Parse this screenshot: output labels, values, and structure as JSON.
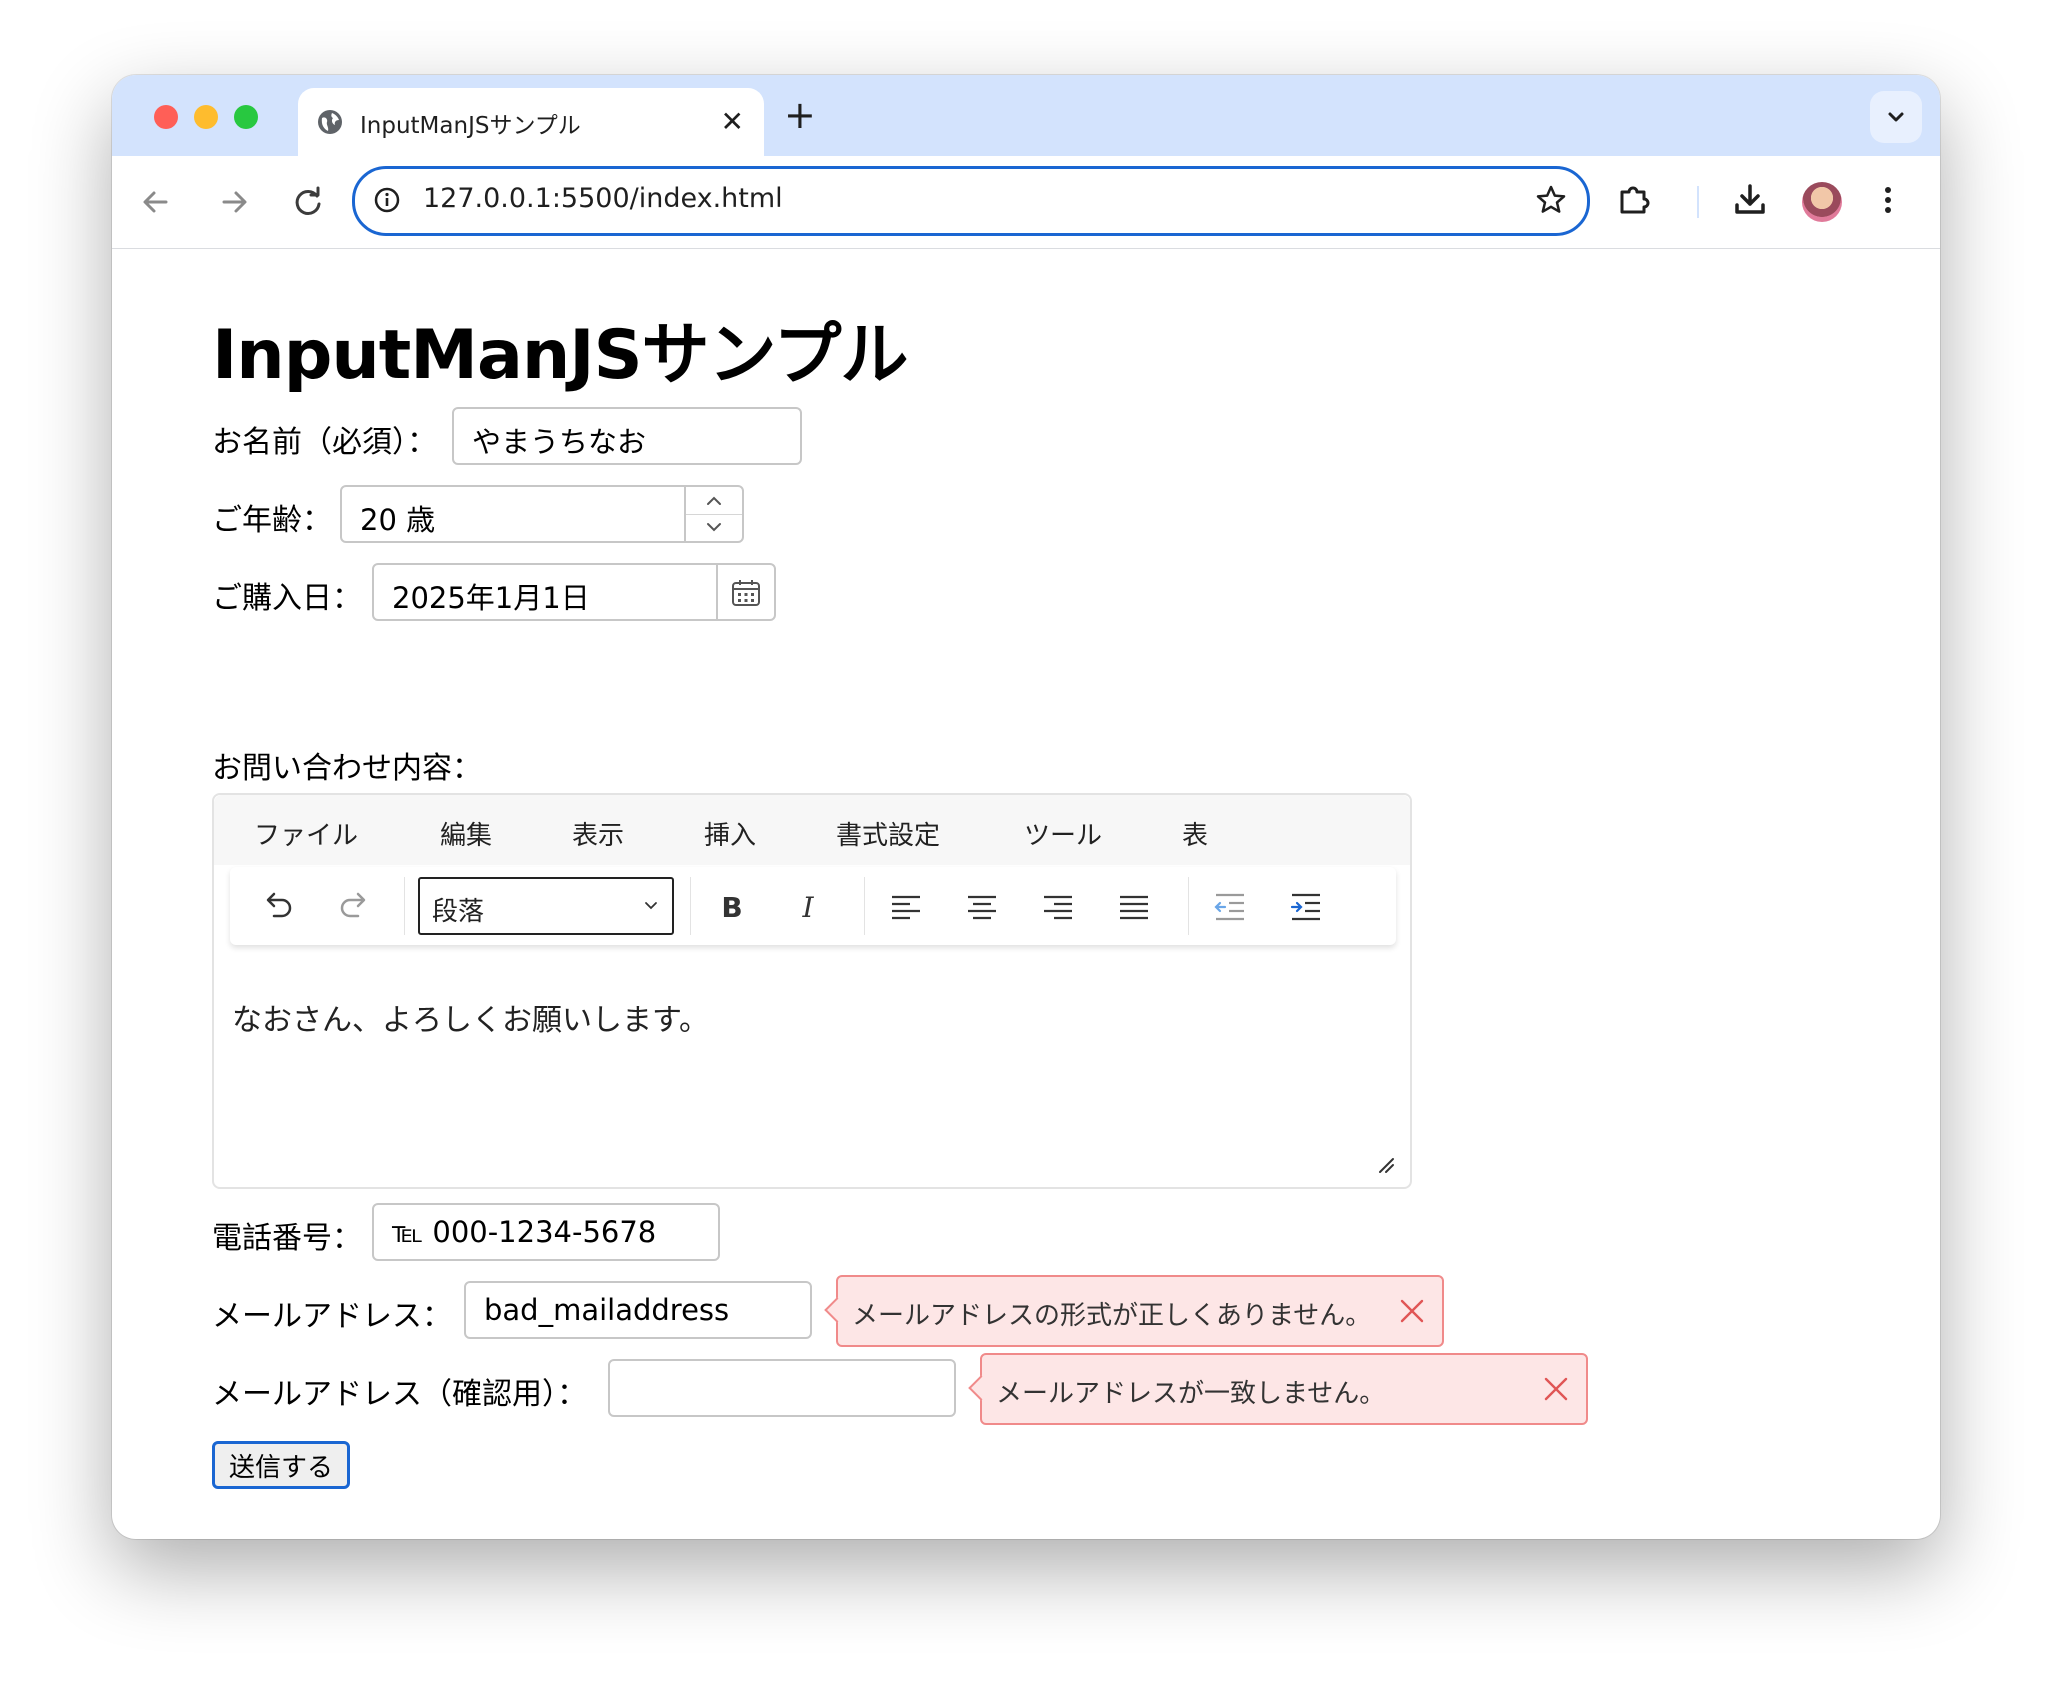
{
  "browser": {
    "tab_title": "InputManJSサンプル",
    "tab_close": "✕",
    "new_tab": "+",
    "url": "127.0.0.1:5500/index.html"
  },
  "page": {
    "heading": "InputManJSサンプル",
    "name": {
      "label": "お名前（必須）：",
      "value": "やまうちなお"
    },
    "age": {
      "label": "ご年齢：",
      "value": "20 歳"
    },
    "purchase_date": {
      "label": "ご購入日：",
      "value": "2025年1月1日"
    },
    "inquiry": {
      "label": "お問い合わせ内容：",
      "menu": [
        "ファイル",
        "編集",
        "表示",
        "挿入",
        "書式設定",
        "ツール",
        "表"
      ],
      "block_format": "段落",
      "content": "なおさん、よろしくお願いします。"
    },
    "phone": {
      "label": "電話番号：",
      "value": "℡ 000-1234-5678"
    },
    "email": {
      "label": "メールアドレス：",
      "value": "bad_mailaddress",
      "error": "メールアドレスの形式が正しくありません。"
    },
    "email_confirm": {
      "label": "メールアドレス（確認用）：",
      "value": "",
      "error": "メールアドレスが一致しません。"
    },
    "submit_label": "送信する"
  },
  "colors": {
    "tabstrip": "#d3e3fd",
    "focus_ring": "#1a66d2",
    "error_bg": "#fde6e6",
    "error_border": "#f08a8a"
  }
}
